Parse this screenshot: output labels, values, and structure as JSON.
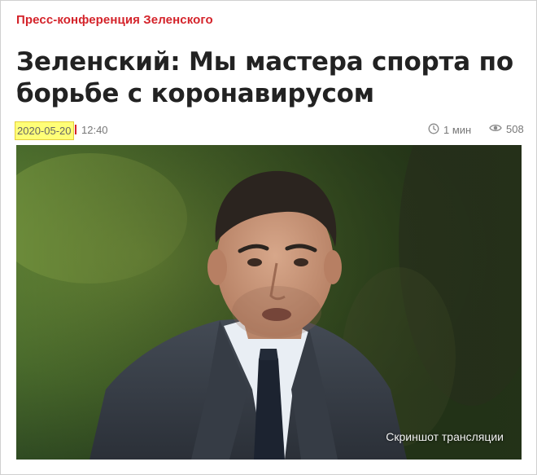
{
  "article": {
    "rubric": "Пресс-конференция Зеленского",
    "title": "Зеленский: Мы мастера спорта по борьбе с коронавирусом",
    "date": "2020-05-20",
    "time": "12:40",
    "read_time": "1 мин",
    "views": "508"
  },
  "photo": {
    "caption": "Скриншот трансляции"
  },
  "icons": {
    "read_time": "clock-icon",
    "views": "eye-icon"
  },
  "colors": {
    "accent": "#d4232a",
    "date_highlight": "#ffff77"
  }
}
